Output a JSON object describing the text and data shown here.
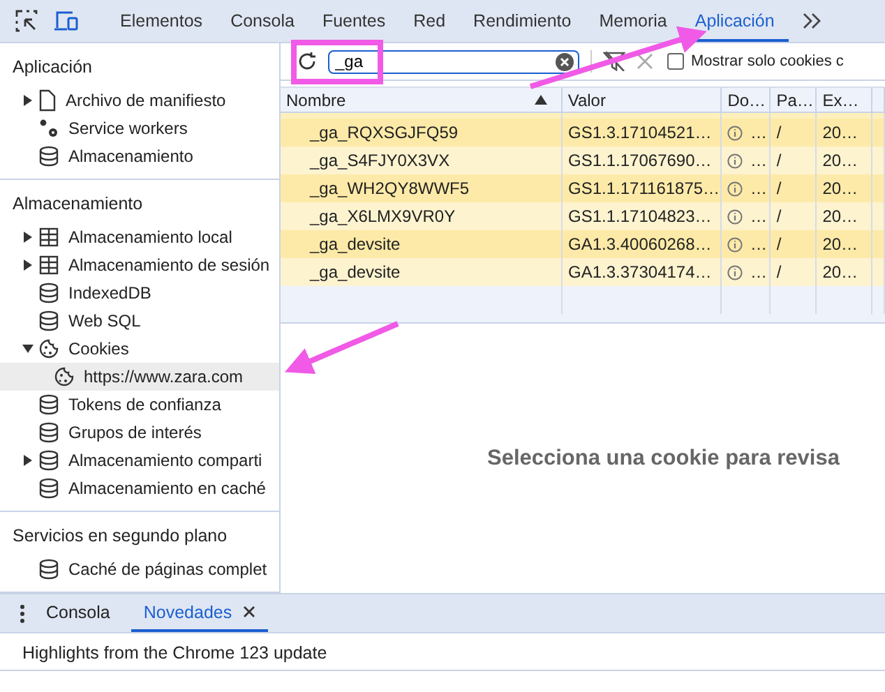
{
  "tabs": [
    {
      "label": "Elementos",
      "selected": false
    },
    {
      "label": "Consola",
      "selected": false
    },
    {
      "label": "Fuentes",
      "selected": false
    },
    {
      "label": "Red",
      "selected": false
    },
    {
      "label": "Rendimiento",
      "selected": false
    },
    {
      "label": "Memoria",
      "selected": false
    },
    {
      "label": "Aplicación",
      "selected": true
    }
  ],
  "sidebar": {
    "sections": [
      {
        "title": "Aplicación",
        "items": [
          {
            "label": "Archivo de manifiesto",
            "kind": "file",
            "expanded": false,
            "selected": false
          },
          {
            "label": "Service workers",
            "kind": "gears",
            "selected": false
          },
          {
            "label": "Almacenamiento",
            "kind": "database",
            "selected": false
          }
        ]
      },
      {
        "title": "Almacenamiento",
        "items": [
          {
            "label": "Almacenamiento local",
            "kind": "table",
            "expanded": false,
            "selected": false
          },
          {
            "label": "Almacenamiento de sesión",
            "kind": "table",
            "expanded": false,
            "selected": false
          },
          {
            "label": "IndexedDB",
            "kind": "database",
            "selected": false
          },
          {
            "label": "Web SQL",
            "kind": "database",
            "selected": false
          },
          {
            "label": "Cookies",
            "kind": "cookie",
            "expanded": true,
            "selected": false,
            "children": [
              {
                "label": "https://www.zara.com",
                "kind": "cookie",
                "selected": true
              }
            ]
          },
          {
            "label": "Tokens de confianza",
            "kind": "database",
            "selected": false
          },
          {
            "label": "Grupos de interés",
            "kind": "database",
            "selected": false
          },
          {
            "label": "Almacenamiento comparti",
            "kind": "database",
            "expanded": false,
            "selected": false
          },
          {
            "label": "Almacenamiento en caché",
            "kind": "database",
            "selected": false
          }
        ]
      },
      {
        "title": "Servicios en segundo plano",
        "items": [
          {
            "label": "Caché de páginas complet",
            "kind": "database",
            "selected": false
          }
        ]
      }
    ]
  },
  "toolbar": {
    "search": {
      "value": "_ga"
    },
    "filter_checkbox": {
      "label": "Mostrar solo cookies c",
      "checked": false
    }
  },
  "table": {
    "columns": [
      {
        "label": "Nombre",
        "kind": "text",
        "sorted": true
      },
      {
        "label": "Valor",
        "kind": "text"
      },
      {
        "label": "Do…",
        "kind": "info"
      },
      {
        "label": "Pa…",
        "kind": "text"
      },
      {
        "label": "Ex…",
        "kind": "text"
      }
    ],
    "rows": [
      {
        "cells": [
          "_ga_RQXSGJFQ59",
          "GS1.3.17104521…",
          "…",
          "/",
          "20…"
        ]
      },
      {
        "cells": [
          "_ga_S4FJY0X3VX",
          "GS1.1.17067690…",
          "…",
          "/",
          "20…"
        ]
      },
      {
        "cells": [
          "_ga_WH2QY8WWF5",
          "GS1.1.171161875…",
          "…",
          "/",
          "20…"
        ]
      },
      {
        "cells": [
          "_ga_X6LMX9VR0Y",
          "GS1.1.17104823…",
          "…",
          "/",
          "20…"
        ]
      },
      {
        "cells": [
          "_ga_devsite",
          "GA1.3.40060268…",
          "…",
          "/",
          "20…"
        ]
      },
      {
        "cells": [
          "_ga_devsite",
          "GA1.3.37304174…",
          "…",
          "/",
          "20…"
        ]
      }
    ]
  },
  "detail_message": "Selecciona una cookie para revisa",
  "drawer": {
    "tabs": [
      {
        "label": "Consola",
        "selected": false,
        "closable": false
      },
      {
        "label": "Novedades",
        "selected": true,
        "closable": true
      }
    ],
    "content": "Highlights from the Chrome 123 update"
  }
}
